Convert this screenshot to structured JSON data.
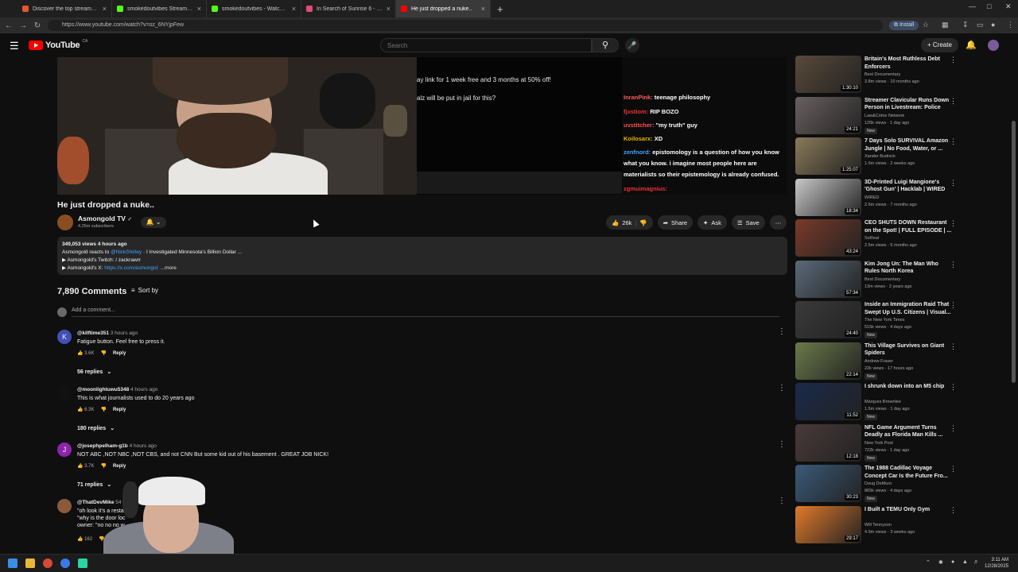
{
  "browser": {
    "tabs": [
      {
        "title": "Discover the top streamed mu",
        "color": "#e4572e",
        "active": false
      },
      {
        "title": "smokedoutvibes Stream - Watc",
        "color": "#53fc18",
        "active": false
      },
      {
        "title": "smokedoutvibes - Watch clips",
        "color": "#53fc18",
        "active": false
      },
      {
        "title": "In Search of Sunrise 6 - Ibiza",
        "color": "#e24b78",
        "active": false
      },
      {
        "title": "He just dropped a nuke..",
        "color": "#ff0000",
        "active": true
      }
    ],
    "new_tab": "+",
    "url": "https://www.youtube.com/watch?v=oz_6NYjpFew",
    "install_label": "Install"
  },
  "youtube": {
    "logo_text": "YouTube",
    "logo_country": "CA",
    "search_placeholder": "Search",
    "create_label": "Create"
  },
  "stream_overlay": {
    "lines": [
      "ay link for 1 week free and 3 months at 50% off!",
      "alz will be put in jail for this?"
    ],
    "chat": [
      {
        "user": "InranPink:",
        "text": "teenage philosophy",
        "color": "#ff5a5a"
      },
      {
        "user": "fjxstiom:",
        "text": "RIP BOZO",
        "color": "#e33"
      },
      {
        "user": "uvstitcher:",
        "text": "\"my truth\" guy",
        "color": "#ff5050"
      },
      {
        "user": "Koilosarx:",
        "text": "XD",
        "color": "#e6b400"
      },
      {
        "user": "zenfnord:",
        "text": "epistomology is a question of how you know what you know. i imagine most people here are materialists so their epistemology is already confused.",
        "color": "#3ea6ff"
      },
      {
        "user": "zgmuimagnius:",
        "text": "",
        "color": "#e33"
      }
    ]
  },
  "video": {
    "title": "He just dropped a nuke..",
    "channel_name": "Asmongold TV",
    "subscribers": "4.25m subscribers",
    "likes": "26k",
    "share_label": "Share",
    "ask_label": "Ask",
    "save_label": "Save",
    "description": {
      "stats": "349,053 views  4 hours ago",
      "line1_prefix": "Asmongold reacts to ",
      "line1_link": "@NickShirley",
      "line1_suffix": " · I Investigated Minnesota's Billion Dollar ...",
      "line2": "▶ Asmongold's Twitch: ",
      "line2_link": "/ zackrawrr",
      "line3": "▶ Asmongold's X: ",
      "line3_link": "https://x.com/asmongol:",
      "more": "...more"
    }
  },
  "comments": {
    "count_label": "7,890 Comments",
    "sort_label": "Sort by",
    "add_placeholder": "Add a comment...",
    "reply_label": "Reply",
    "items": [
      {
        "avatar_letter": "K",
        "avatar_color": "#3f51b5",
        "user": "@kilftime351",
        "time": "3 hours ago",
        "text": "Fatigue button. Feel free to press it.",
        "likes": "3.6K",
        "replies": "56 replies"
      },
      {
        "avatar_letter": "",
        "avatar_color": "#111111",
        "user": "@moonlightuwu5348",
        "time": "4 hours ago",
        "text": "This is what journalists used to do 20 years ago",
        "likes": "6.3K",
        "replies": "180 replies"
      },
      {
        "avatar_letter": "J",
        "avatar_color": "#8e24aa",
        "user": "@josephpelham-g1b",
        "time": "4 hours ago",
        "text": "NOT ABC ,NOT NBC ,NOT CBS, and not CNN But some kid out of his basement . GREAT JOB NICK!",
        "likes": "3.7K",
        "replies": "71 replies"
      },
      {
        "avatar_letter": "",
        "avatar_color": "#8a5a3a",
        "user": "@ThatDevMike",
        "time": "54 mi",
        "text": "\"oh look it's a restau\n\"why is the door loc\nowner: \"no no no w",
        "likes": "162",
        "replies": ""
      }
    ]
  },
  "related": [
    {
      "title": "Britain's Most Ruthless Debt Enforcers",
      "channel": "Best Documentary",
      "meta": "3.8m views · 10 months ago",
      "duration": "1:30:10",
      "new": "",
      "color": "#5a4a3a"
    },
    {
      "title": "Streamer Clavicular Runs Down Person in Livestream: Police",
      "channel": "Law&Crime Network",
      "meta": "126k views · 1 day ago",
      "duration": "24:21",
      "new": "New",
      "color": "#6a6060"
    },
    {
      "title": "7 Days Solo SURVIVAL Amazon Jungle | No Food, Water, or ...",
      "channel": "Xander Budnick",
      "meta": "1.6m views · 2 weeks ago",
      "duration": "1:25:07",
      "new": "",
      "color": "#8a7a5a"
    },
    {
      "title": "3D-Printed Luigi Mangione's 'Ghost Gun' | Hacklab | WIRED",
      "channel": "WIRED",
      "meta": "2.6m views · 7 months ago",
      "duration": "18:34",
      "new": "",
      "color": "#c8c8c8"
    },
    {
      "title": "CEO SHUTS DOWN Restaurant on the Spot! | FULL EPISODE | ...",
      "channel": "SoReal",
      "meta": "2.5m views · 5 months ago",
      "duration": "43:24",
      "new": "",
      "color": "#7a3a2a"
    },
    {
      "title": "Kim Jong Un: The Man Who Rules North Korea",
      "channel": "Best Documentary",
      "meta": "13m views · 2 years ago",
      "duration": "57:34",
      "new": "",
      "color": "#5a6a7a"
    },
    {
      "title": "Inside an Immigration Raid That Swept Up U.S. Citizens | Visual...",
      "channel": "The New York Times",
      "meta": "515k views · 4 days ago",
      "duration": "24:40",
      "new": "New",
      "color": "#3a3a3a"
    },
    {
      "title": "This Village Survives on Giant Spiders",
      "channel": "Andrew Fraser",
      "meta": "22k views · 17 hours ago",
      "duration": "22:14",
      "new": "New",
      "color": "#6a7a4a"
    },
    {
      "title": "I shrunk down into an M5 chip",
      "channel": "Marques Brownlee",
      "meta": "1.5m views · 1 day ago",
      "duration": "11:52",
      "new": "New",
      "color": "#1a2a4a"
    },
    {
      "title": "NFL Game Argument Turns Deadly as Florida Man Kills ...",
      "channel": "New York Post",
      "meta": "722k views · 1 day ago",
      "duration": "12:18",
      "new": "New",
      "color": "#4a3a3a"
    },
    {
      "title": "The 1988 Cadillac Voyage Concept Car Is the Future Fro...",
      "channel": "Doug DeMuro",
      "meta": "865k views · 4 days ago",
      "duration": "30:23",
      "new": "New",
      "color": "#3a5a7a"
    },
    {
      "title": "I Built a TEMU Only Gym",
      "channel": "Will Tennyson",
      "meta": "4.9m views · 3 weeks ago",
      "duration": "29:17",
      "new": "",
      "color": "#e27a2a"
    }
  ],
  "taskbar": {
    "time": "3:11 AM",
    "date": "12/28/2025"
  }
}
